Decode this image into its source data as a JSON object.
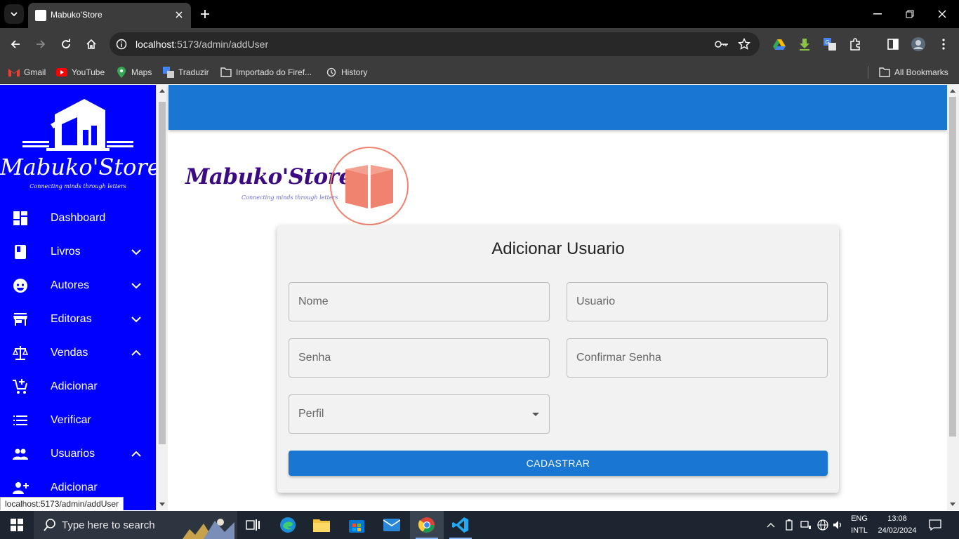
{
  "browser": {
    "tab_title": "Mabuko'Store",
    "url_host": "localhost",
    "url_rest": ":5173/admin/addUser",
    "bookmarks": [
      {
        "label": "Gmail"
      },
      {
        "label": "YouTube"
      },
      {
        "label": "Maps"
      },
      {
        "label": "Traduzir"
      },
      {
        "label": "Importado do Firef..."
      },
      {
        "label": "History"
      }
    ],
    "all_bookmarks": "All Bookmarks",
    "status_url": "localhost:5173/admin/addUser"
  },
  "sidebar": {
    "brand": "Mabuko'Store",
    "tagline": "Connecting minds through letters",
    "items": [
      {
        "label": "Dashboard",
        "icon": "dashboard-icon",
        "chevron": ""
      },
      {
        "label": "Livros",
        "icon": "book-icon",
        "chevron": "down"
      },
      {
        "label": "Autores",
        "icon": "face-icon",
        "chevron": "down"
      },
      {
        "label": "Editoras",
        "icon": "store-icon",
        "chevron": "down"
      },
      {
        "label": "Vendas",
        "icon": "scale-icon",
        "chevron": "up"
      },
      {
        "label": "Adicionar",
        "icon": "add-cart-icon",
        "chevron": ""
      },
      {
        "label": "Verificar",
        "icon": "list-icon",
        "chevron": ""
      },
      {
        "label": "Usuarios",
        "icon": "people-icon",
        "chevron": "up"
      },
      {
        "label": "Adicionar",
        "icon": "person-add-icon",
        "chevron": ""
      }
    ]
  },
  "main": {
    "store_name": "Mabuko'Store",
    "store_tagline": "Connecting minds through letters",
    "form": {
      "title": "Adicionar Usuario",
      "nome_placeholder": "Nome",
      "usuario_placeholder": "Usuario",
      "senha_placeholder": "Senha",
      "confirmar_placeholder": "Confirmar Senha",
      "perfil_label": "Perfil",
      "submit_label": "CADASTRAR"
    }
  },
  "taskbar": {
    "search_placeholder": "Type here to search",
    "lang_top": "ENG",
    "lang_bottom": "INTL",
    "time": "13:08",
    "date": "24/02/2024"
  },
  "colors": {
    "sidebar_bg": "#0000fe",
    "appbar_bg": "#1976d2",
    "brand_purple": "#3c0a82",
    "book_coral": "#f08370"
  }
}
